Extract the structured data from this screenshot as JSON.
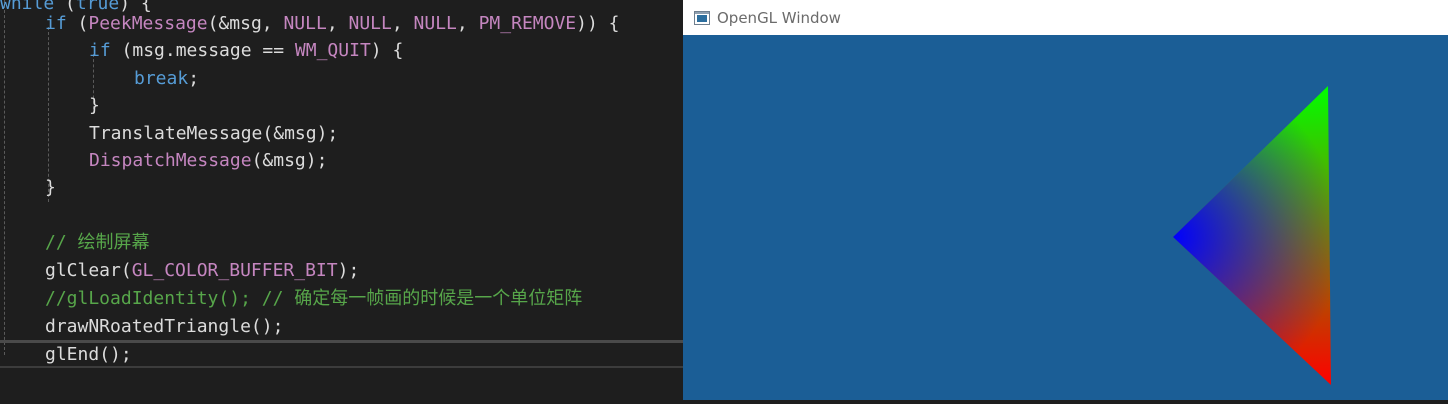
{
  "editor": {
    "lines": [
      {
        "id": "while",
        "tokens": [
          {
            "t": "while",
            "c": "kw"
          },
          {
            "t": " (",
            "c": "fn"
          },
          {
            "t": "true",
            "c": "kw"
          },
          {
            "t": ") {",
            "c": "fn"
          }
        ]
      },
      {
        "id": "if-peek",
        "tokens": [
          {
            "t": "if",
            "c": "kw"
          },
          {
            "t": " (",
            "c": "fn"
          },
          {
            "t": "PeekMessage",
            "c": "mac"
          },
          {
            "t": "(&msg, ",
            "c": "fn"
          },
          {
            "t": "NULL",
            "c": "mac"
          },
          {
            "t": ", ",
            "c": "fn"
          },
          {
            "t": "NULL",
            "c": "mac"
          },
          {
            "t": ", ",
            "c": "fn"
          },
          {
            "t": "NULL",
            "c": "mac"
          },
          {
            "t": ", ",
            "c": "fn"
          },
          {
            "t": "PM_REMOVE",
            "c": "mac"
          },
          {
            "t": ")) {",
            "c": "fn"
          }
        ]
      },
      {
        "id": "if-quit",
        "tokens": [
          {
            "t": "if",
            "c": "kw"
          },
          {
            "t": " (msg.message == ",
            "c": "fn"
          },
          {
            "t": "WM_QUIT",
            "c": "mac"
          },
          {
            "t": ") {",
            "c": "fn"
          }
        ]
      },
      {
        "id": "break",
        "tokens": [
          {
            "t": "break",
            "c": "kw"
          },
          {
            "t": ";",
            "c": "fn"
          }
        ]
      },
      {
        "id": "close-inner",
        "tokens": [
          {
            "t": "}",
            "c": "fn"
          }
        ]
      },
      {
        "id": "translate",
        "tokens": [
          {
            "t": "TranslateMessage",
            "c": "fn"
          },
          {
            "t": "(&msg);",
            "c": "fn"
          }
        ]
      },
      {
        "id": "dispatch",
        "tokens": [
          {
            "t": "DispatchMessage",
            "c": "mac"
          },
          {
            "t": "(&msg);",
            "c": "fn"
          }
        ]
      },
      {
        "id": "close-if",
        "tokens": [
          {
            "t": "}",
            "c": "fn"
          }
        ]
      },
      {
        "id": "blank",
        "tokens": []
      },
      {
        "id": "comment-draw",
        "tokens": [
          {
            "t": "// 绘制屏幕",
            "c": "cm"
          }
        ]
      },
      {
        "id": "glclear",
        "tokens": [
          {
            "t": "glClear",
            "c": "fn"
          },
          {
            "t": "(",
            "c": "fn"
          },
          {
            "t": "GL_COLOR_BUFFER_BIT",
            "c": "mac"
          },
          {
            "t": ");",
            "c": "fn"
          }
        ]
      },
      {
        "id": "comment-identity",
        "tokens": [
          {
            "t": "//glLoadIdentity(); // 确定每一帧画的时候是一个单位矩阵",
            "c": "cm"
          }
        ]
      },
      {
        "id": "draw-call",
        "tokens": [
          {
            "t": "drawNRoatedTriangle",
            "c": "fn"
          },
          {
            "t": "();",
            "c": "fn"
          }
        ]
      },
      {
        "id": "glend",
        "tokens": [
          {
            "t": "glEnd",
            "c": "fn"
          },
          {
            "t": "();",
            "c": "fn"
          }
        ]
      }
    ]
  },
  "gl_window": {
    "title": "OpenGL Window",
    "icon": "window-app-icon",
    "clear_color": "#1b5e96",
    "triangle": {
      "vertex_colors": [
        "#00ff00",
        "#0000ff",
        "#ff0000"
      ]
    }
  }
}
